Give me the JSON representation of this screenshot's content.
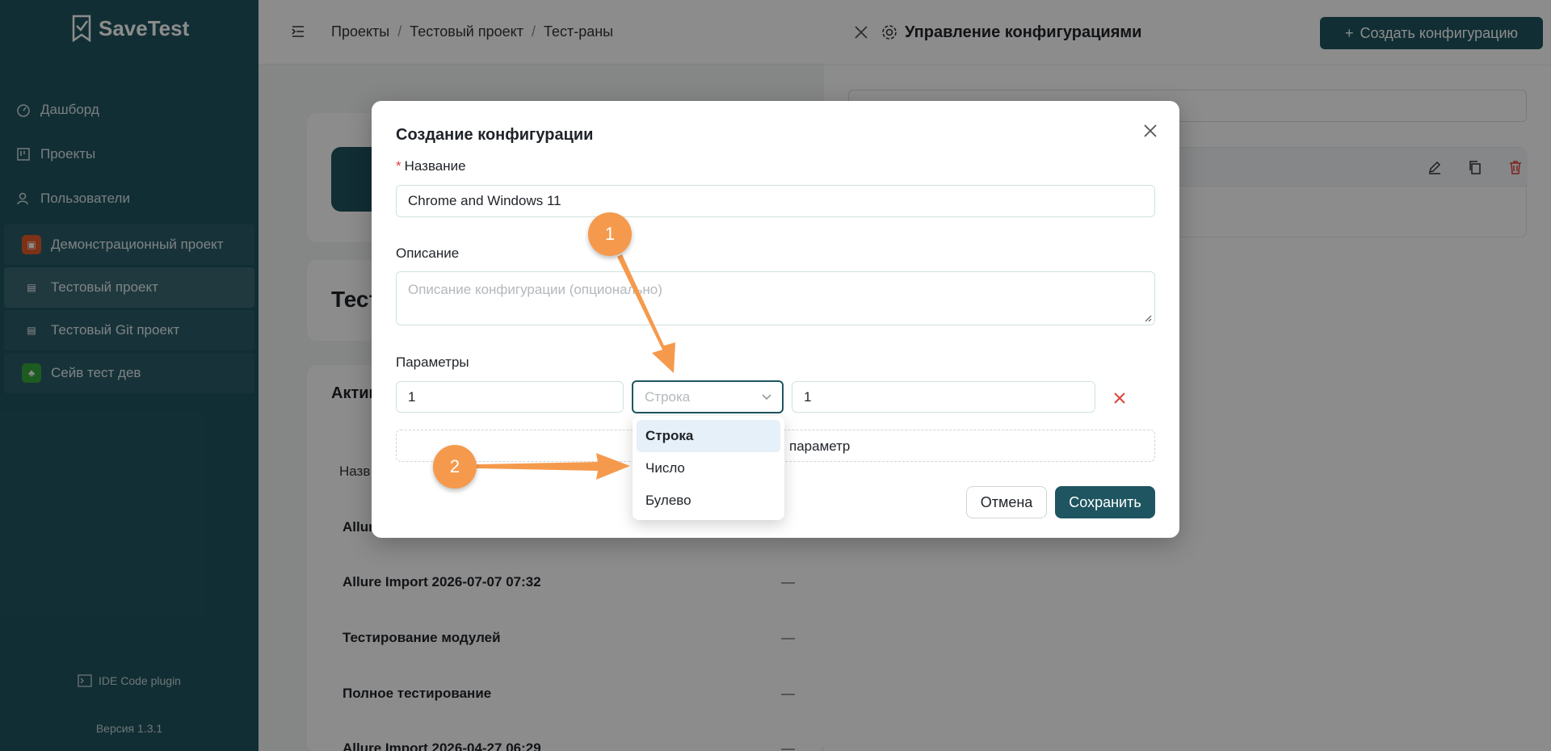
{
  "app": {
    "name": "SaveTest",
    "version": "Версия 1.3.1",
    "plugin": "IDE Code plugin"
  },
  "sidebar": {
    "nav": [
      {
        "label": "Дашборд",
        "icon": "dashboard-icon"
      },
      {
        "label": "Проекты",
        "icon": "projects-icon"
      },
      {
        "label": "Пользователи",
        "icon": "users-icon"
      }
    ],
    "projects": [
      {
        "label": "Демонстрационный проект",
        "color": "#e35a2b"
      },
      {
        "label": "Тестовый проект",
        "color": ""
      },
      {
        "label": "Тестовый Git проект",
        "color": ""
      },
      {
        "label": "Сейв тест дев",
        "color": "#37a63b"
      }
    ]
  },
  "breadcrumb": [
    "Проекты",
    "Тестовый проект",
    "Тест-раны"
  ],
  "main": {
    "card_title": "Тест",
    "tab_active": "Актив",
    "table_header": "Назв",
    "rows": [
      {
        "name": "Allur",
        "value": ""
      },
      {
        "name": "Allure Import 2026-07-07 07:32",
        "value": "—"
      },
      {
        "name": "Тестирование модулей",
        "value": "—"
      },
      {
        "name": "Полное тестирование",
        "value": "—"
      },
      {
        "name": "Allure Import 2026-04-27 06:29",
        "value": "—"
      }
    ]
  },
  "drawer": {
    "title": "Управление конфигурациями",
    "create_button": "Создать конфигурацию"
  },
  "modal": {
    "title": "Создание конфигурации",
    "name_label": "Название",
    "name_value": "Chrome and Windows 11",
    "description_label": "Описание",
    "description_placeholder": "Описание конфигурации (опционально)",
    "params_label": "Параметры",
    "param_key": "1",
    "param_type_placeholder": "Строка",
    "param_value": "1",
    "add_param_label": "параметр",
    "cancel": "Отмена",
    "save": "Сохранить"
  },
  "dropdown": {
    "options": [
      "Строка",
      "Число",
      "Булево"
    ],
    "selected": "Строка"
  },
  "annotations": {
    "first": "1",
    "second": "2"
  },
  "colors": {
    "brand": "#1f5560",
    "accent_orange": "#f59a4d",
    "danger": "#e0423d"
  }
}
